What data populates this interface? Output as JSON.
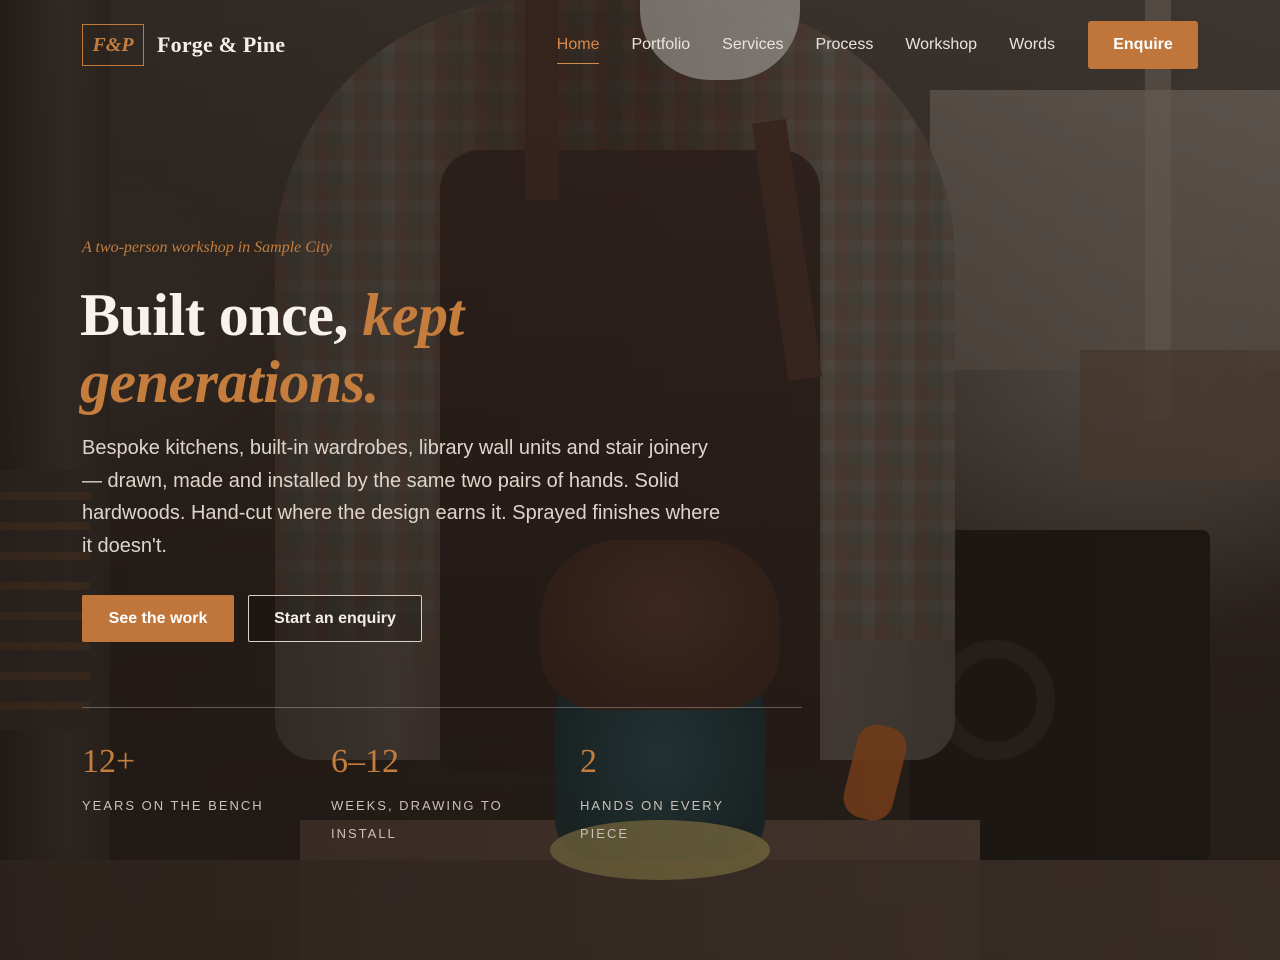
{
  "brand": {
    "mark": "F&P",
    "name": "Forge & Pine"
  },
  "nav": {
    "items": [
      {
        "label": "Home",
        "active": true
      },
      {
        "label": "Portfolio",
        "active": false
      },
      {
        "label": "Services",
        "active": false
      },
      {
        "label": "Process",
        "active": false
      },
      {
        "label": "Workshop",
        "active": false
      },
      {
        "label": "Words",
        "active": false
      }
    ],
    "cta_label": "Enquire"
  },
  "hero": {
    "eyebrow": "A two-person workshop in Sample City",
    "headline_plain": "Built once, ",
    "headline_accent_1": "kept",
    "headline_accent_2": "generations.",
    "lede": "Bespoke kitchens, built-in wardrobes, library wall units and stair joinery — drawn, made and installed by the same two pairs of hands. Solid hardwoods. Hand-cut where the design earns it. Sprayed finishes where it doesn't.",
    "primary_cta": "See the work",
    "secondary_cta": "Start an enquiry"
  },
  "stats": [
    {
      "value": "12+",
      "label": "Years on the bench"
    },
    {
      "value": "6–12",
      "label": "Weeks, drawing to install"
    },
    {
      "value": "2",
      "label": "Hands on every piece"
    }
  ],
  "colors": {
    "accent": "#c0763a",
    "accent_text": "#c47d3c",
    "background": "#2b221c",
    "text": "#f7f2ec"
  }
}
